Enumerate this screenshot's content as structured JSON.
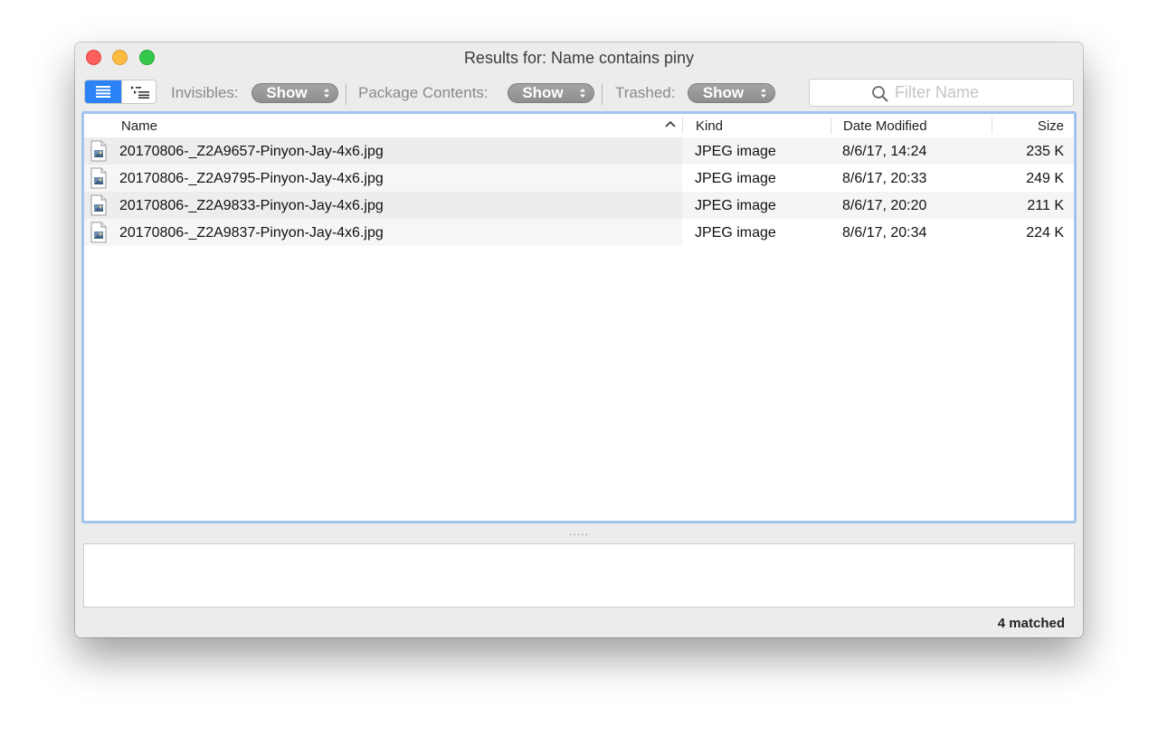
{
  "window": {
    "title": "Results for: Name contains piny"
  },
  "toolbar": {
    "view_buttons": [
      "list-view",
      "outline-view"
    ],
    "filters": [
      {
        "label": "Invisibles:",
        "value": "Show"
      },
      {
        "label": "Package Contents:",
        "value": "Show"
      },
      {
        "label": "Trashed:",
        "value": "Show"
      }
    ],
    "search": {
      "placeholder": "Filter Name",
      "value": ""
    }
  },
  "table": {
    "columns": {
      "name": "Name",
      "kind": "Kind",
      "date": "Date Modified",
      "size": "Size"
    },
    "sort": {
      "column": "Name",
      "direction": "ascending"
    },
    "rows": [
      {
        "name": "20170806-_Z2A9657-Pinyon-Jay-4x6.jpg",
        "kind": "JPEG image",
        "date": "8/6/17, 14:24",
        "size": "235 K"
      },
      {
        "name": "20170806-_Z2A9795-Pinyon-Jay-4x6.jpg",
        "kind": "JPEG image",
        "date": "8/6/17, 20:33",
        "size": "249 K"
      },
      {
        "name": "20170806-_Z2A9833-Pinyon-Jay-4x6.jpg",
        "kind": "JPEG image",
        "date": "8/6/17, 20:20",
        "size": "211 K"
      },
      {
        "name": "20170806-_Z2A9837-Pinyon-Jay-4x6.jpg",
        "kind": "JPEG image",
        "date": "8/6/17, 20:34",
        "size": "224 K"
      }
    ]
  },
  "splitter": {
    "grip": "....."
  },
  "status": {
    "matched": "4 matched"
  },
  "colors": {
    "accent": "#2c82f7",
    "focus_ring": "#a2c4ee",
    "popup": "#999999"
  }
}
